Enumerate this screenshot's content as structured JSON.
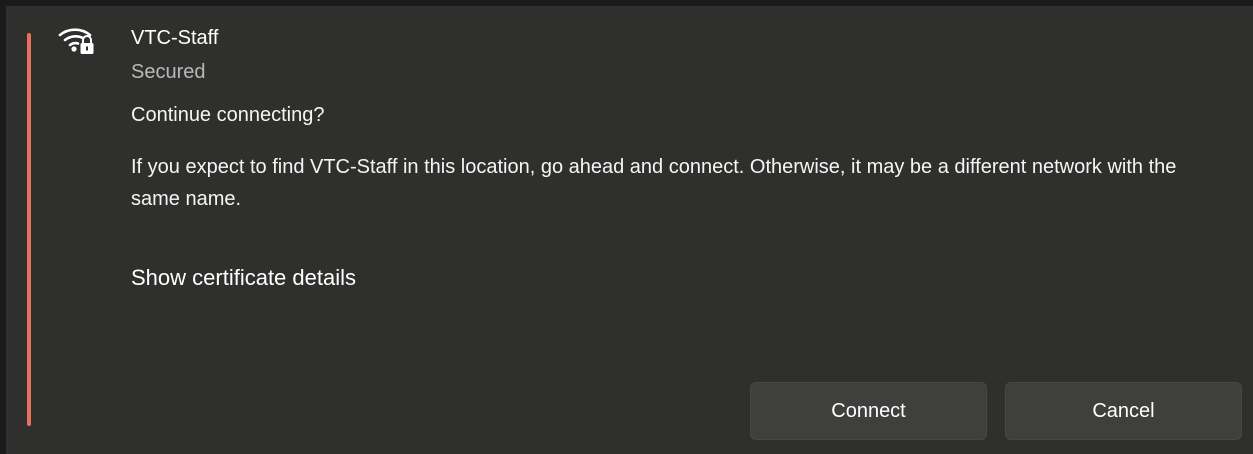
{
  "network": {
    "name": "VTC-Staff",
    "status": "Secured",
    "icon": "wifi-secured-icon"
  },
  "prompt": {
    "question": "Continue connecting?",
    "message": "If you expect to find VTC-Staff in this location, go ahead and connect. Otherwise, it may be a different network with the same name.",
    "certificate_link": "Show certificate details"
  },
  "actions": {
    "connect_label": "Connect",
    "cancel_label": "Cancel"
  },
  "colors": {
    "background": "#2f302d",
    "accent": "#e8715e",
    "button": "#3f403d",
    "secondary_text": "#b9b9b9"
  }
}
